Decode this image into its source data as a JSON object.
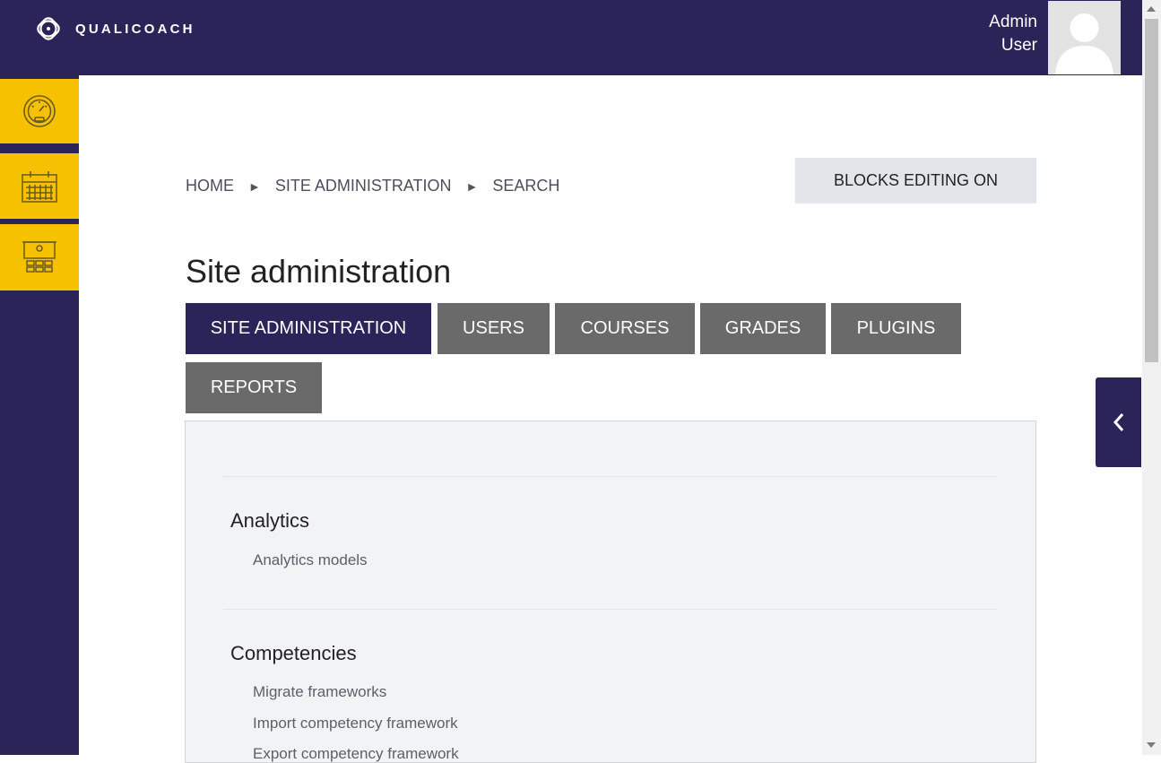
{
  "header": {
    "brand": "QUALICOACH",
    "user_first": "Admin",
    "user_last": "User"
  },
  "sidebar": {
    "items": [
      {
        "icon": "dashboard-gauge-icon"
      },
      {
        "icon": "calendar-icon"
      },
      {
        "icon": "classroom-presentation-icon"
      }
    ]
  },
  "breadcrumb": {
    "items": [
      "HOME",
      "SITE ADMINISTRATION",
      "SEARCH"
    ],
    "separator": "►"
  },
  "blocks_button": "BLOCKS EDITING ON",
  "page_title": "Site administration",
  "tabs": [
    {
      "label": "SITE ADMINISTRATION",
      "active": true
    },
    {
      "label": "USERS",
      "active": false
    },
    {
      "label": "COURSES",
      "active": false
    },
    {
      "label": "GRADES",
      "active": false
    },
    {
      "label": "PLUGINS",
      "active": false
    },
    {
      "label": "REPORTS",
      "active": false
    }
  ],
  "sections": [
    {
      "title": "Analytics",
      "links": [
        "Analytics models"
      ]
    },
    {
      "title": "Competencies",
      "links": [
        "Migrate frameworks",
        "Import competency framework",
        "Export competency framework"
      ]
    }
  ],
  "colors": {
    "brand_navy": "#2b2459",
    "accent_yellow": "#f6c200",
    "tab_gray": "#6a6a6a"
  }
}
